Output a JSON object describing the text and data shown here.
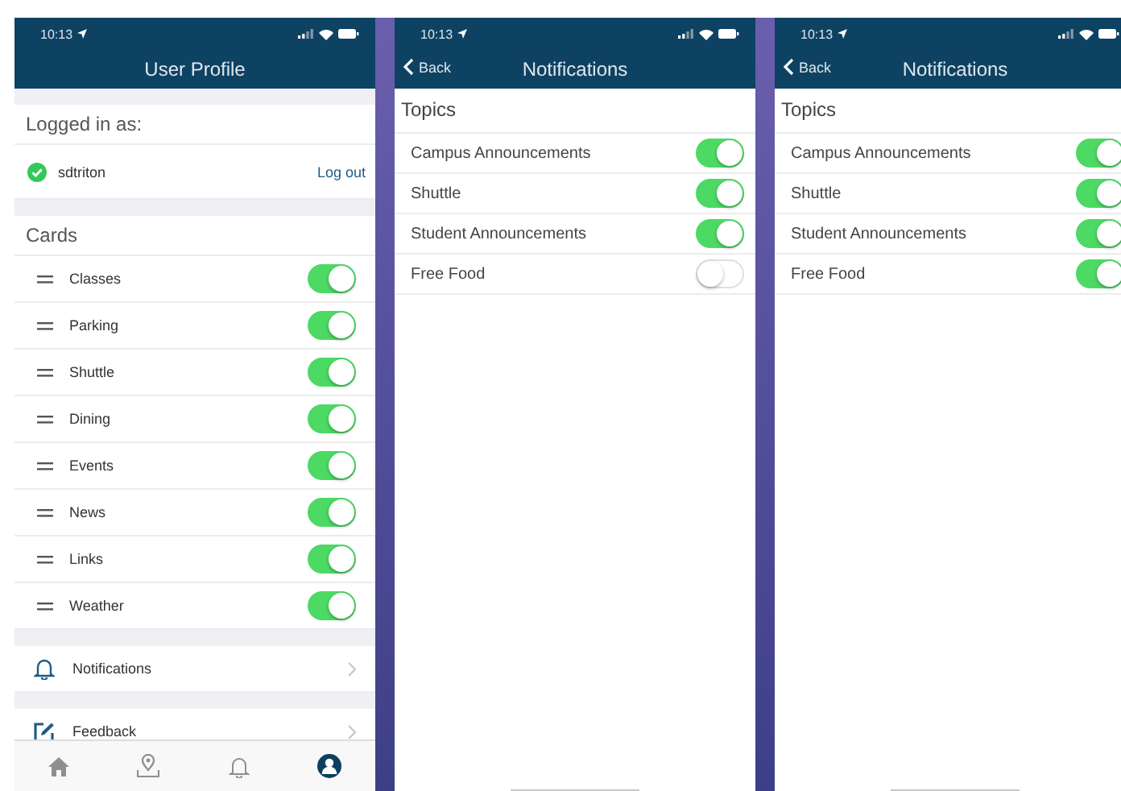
{
  "screens": [
    {
      "kind": "profile",
      "time": "10:13",
      "title": "User Profile",
      "logged_in_label": "Logged in as:",
      "username": "sdtriton",
      "logout": "Log out",
      "cards_label": "Cards",
      "cards": [
        {
          "label": "Classes",
          "on": true
        },
        {
          "label": "Parking",
          "on": true
        },
        {
          "label": "Shuttle",
          "on": true
        },
        {
          "label": "Dining",
          "on": true
        },
        {
          "label": "Events",
          "on": true
        },
        {
          "label": "News",
          "on": true
        },
        {
          "label": "Links",
          "on": true
        },
        {
          "label": "Weather",
          "on": true
        }
      ],
      "menu": [
        {
          "kind": "bell",
          "label": "Notifications"
        },
        {
          "kind": "edit",
          "label": "Feedback"
        }
      ],
      "tabs": [
        {
          "kind": "home",
          "selected": false
        },
        {
          "kind": "map",
          "selected": false
        },
        {
          "kind": "bell",
          "selected": false
        },
        {
          "kind": "profile",
          "selected": true
        }
      ]
    },
    {
      "kind": "topics",
      "time": "10:13",
      "back": "Back",
      "title": "Notifications",
      "section": "Topics",
      "topics": [
        {
          "label": "Campus Announcements",
          "on": true
        },
        {
          "label": "Shuttle",
          "on": true
        },
        {
          "label": "Student Announcements",
          "on": true
        },
        {
          "label": "Free Food",
          "on": false
        }
      ]
    },
    {
      "kind": "topics",
      "time": "10:13",
      "back": "Back",
      "title": "Notifications",
      "section": "Topics",
      "topics": [
        {
          "label": "Campus Announcements",
          "on": true
        },
        {
          "label": "Shuttle",
          "on": true
        },
        {
          "label": "Student Announcements",
          "on": true
        },
        {
          "label": "Free Food",
          "on": true
        }
      ]
    }
  ]
}
